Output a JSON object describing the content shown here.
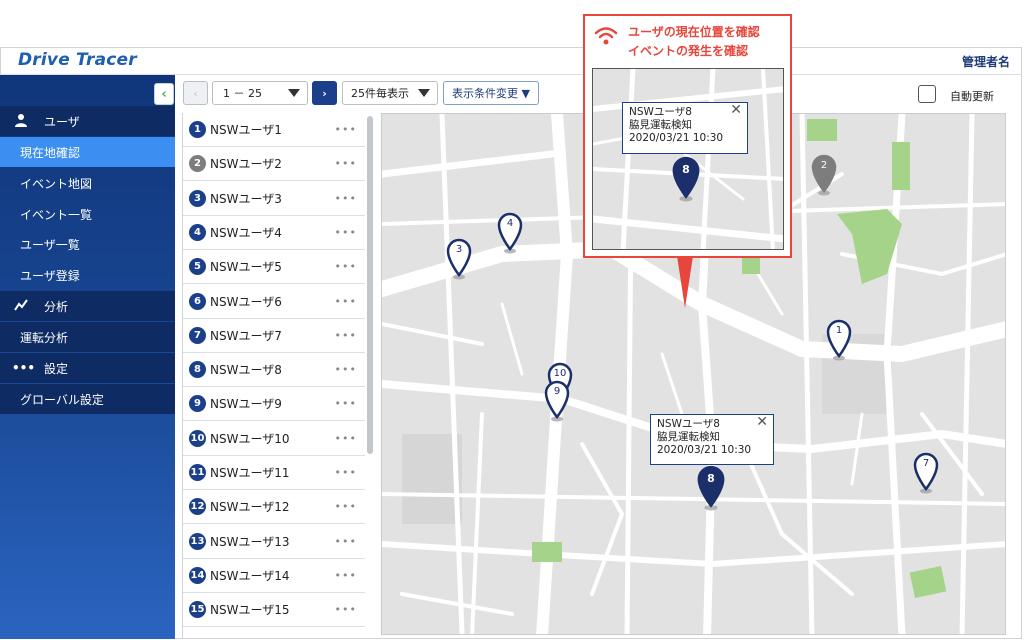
{
  "app": {
    "brand": "Drive Tracer",
    "admin_label": "管理者名"
  },
  "sidebar": {
    "collapse_icon": "chevron-left-icon",
    "sections": [
      {
        "label": "ユーザ",
        "icon": "user-icon",
        "items": [
          {
            "label": "現在地確認",
            "active": true
          },
          {
            "label": "イベント地図"
          },
          {
            "label": "イベント一覧"
          },
          {
            "label": "ユーザ一覧"
          },
          {
            "label": "ユーザ登録"
          }
        ]
      },
      {
        "label": "分析",
        "icon": "chart-icon",
        "items": [
          {
            "label": "運転分析"
          }
        ]
      },
      {
        "label": "設定",
        "icon": "more-icon",
        "items": [
          {
            "label": "グローバル設定"
          }
        ]
      }
    ]
  },
  "toolbar": {
    "range_value": "1 － 25",
    "per_page_value": "25件毎表示",
    "condition_button": "表示条件変更 ▼",
    "auto_refresh_label": "自動更新",
    "auto_refresh_checked": false
  },
  "user_list": [
    {
      "num": "1",
      "name": "NSWユーザ1"
    },
    {
      "num": "2",
      "name": "NSWユーザ2",
      "status": "gray"
    },
    {
      "num": "3",
      "name": "NSWユーザ3"
    },
    {
      "num": "4",
      "name": "NSWユーザ4"
    },
    {
      "num": "5",
      "name": "NSWユーザ5"
    },
    {
      "num": "6",
      "name": "NSWユーザ6"
    },
    {
      "num": "7",
      "name": "NSWユーザ7"
    },
    {
      "num": "8",
      "name": "NSWユーザ8"
    },
    {
      "num": "9",
      "name": "NSWユーザ9"
    },
    {
      "num": "10",
      "name": "NSWユーザ10"
    },
    {
      "num": "11",
      "name": "NSWユーザ11"
    },
    {
      "num": "12",
      "name": "NSWユーザ12"
    },
    {
      "num": "13",
      "name": "NSWユーザ13"
    },
    {
      "num": "14",
      "name": "NSWユーザ14"
    },
    {
      "num": "15",
      "name": "NSWユーザ15"
    }
  ],
  "row_menu": "•••",
  "map": {
    "pins": [
      "1",
      "2",
      "3",
      "4",
      "7",
      "8",
      "9",
      "10"
    ],
    "popup": {
      "user": "NSWユーザ8",
      "event": "脇見運転検知",
      "time": "2020/03/21 10:30",
      "close": "✕"
    }
  },
  "callout": {
    "line1": "ユーザの現在位置を確認",
    "line2": "イベントの発生を確認",
    "icon": "wifi-icon",
    "pin": "8",
    "popup": {
      "user": "NSWユーザ8",
      "event": "脇見運転検知",
      "time": "2020/03/21 10:30",
      "close": "✕"
    }
  },
  "colors": {
    "brand": "#1e5fb0",
    "sidebar": "#10357a",
    "active": "#3c8ff0",
    "pin": "#1b2f6b",
    "pin_gray": "#7d7d7d",
    "callout": "#e8453c",
    "park": "#a6d38a"
  }
}
